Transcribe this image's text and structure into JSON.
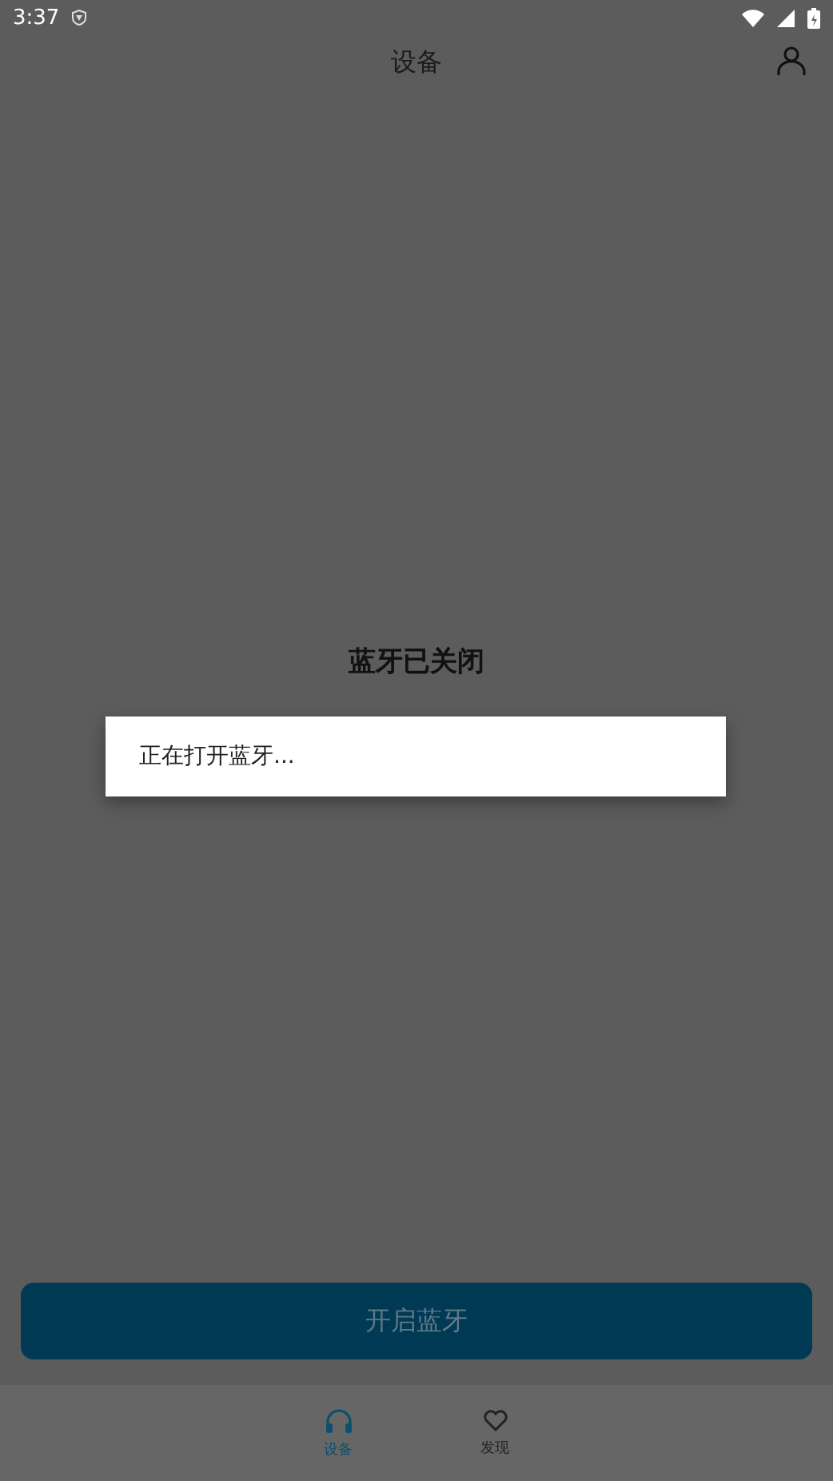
{
  "status_bar": {
    "time": "3:37"
  },
  "header": {
    "title": "设备"
  },
  "bluetooth_notice": {
    "title": "蓝牙已关闭"
  },
  "dialog": {
    "message": "正在打开蓝牙..."
  },
  "primary_button": {
    "label": "开启蓝牙"
  },
  "bottom_nav": [
    {
      "label": "设备",
      "kind": "headphones",
      "selected": true
    },
    {
      "label": "发现",
      "kind": "heart",
      "selected": false
    }
  ]
}
